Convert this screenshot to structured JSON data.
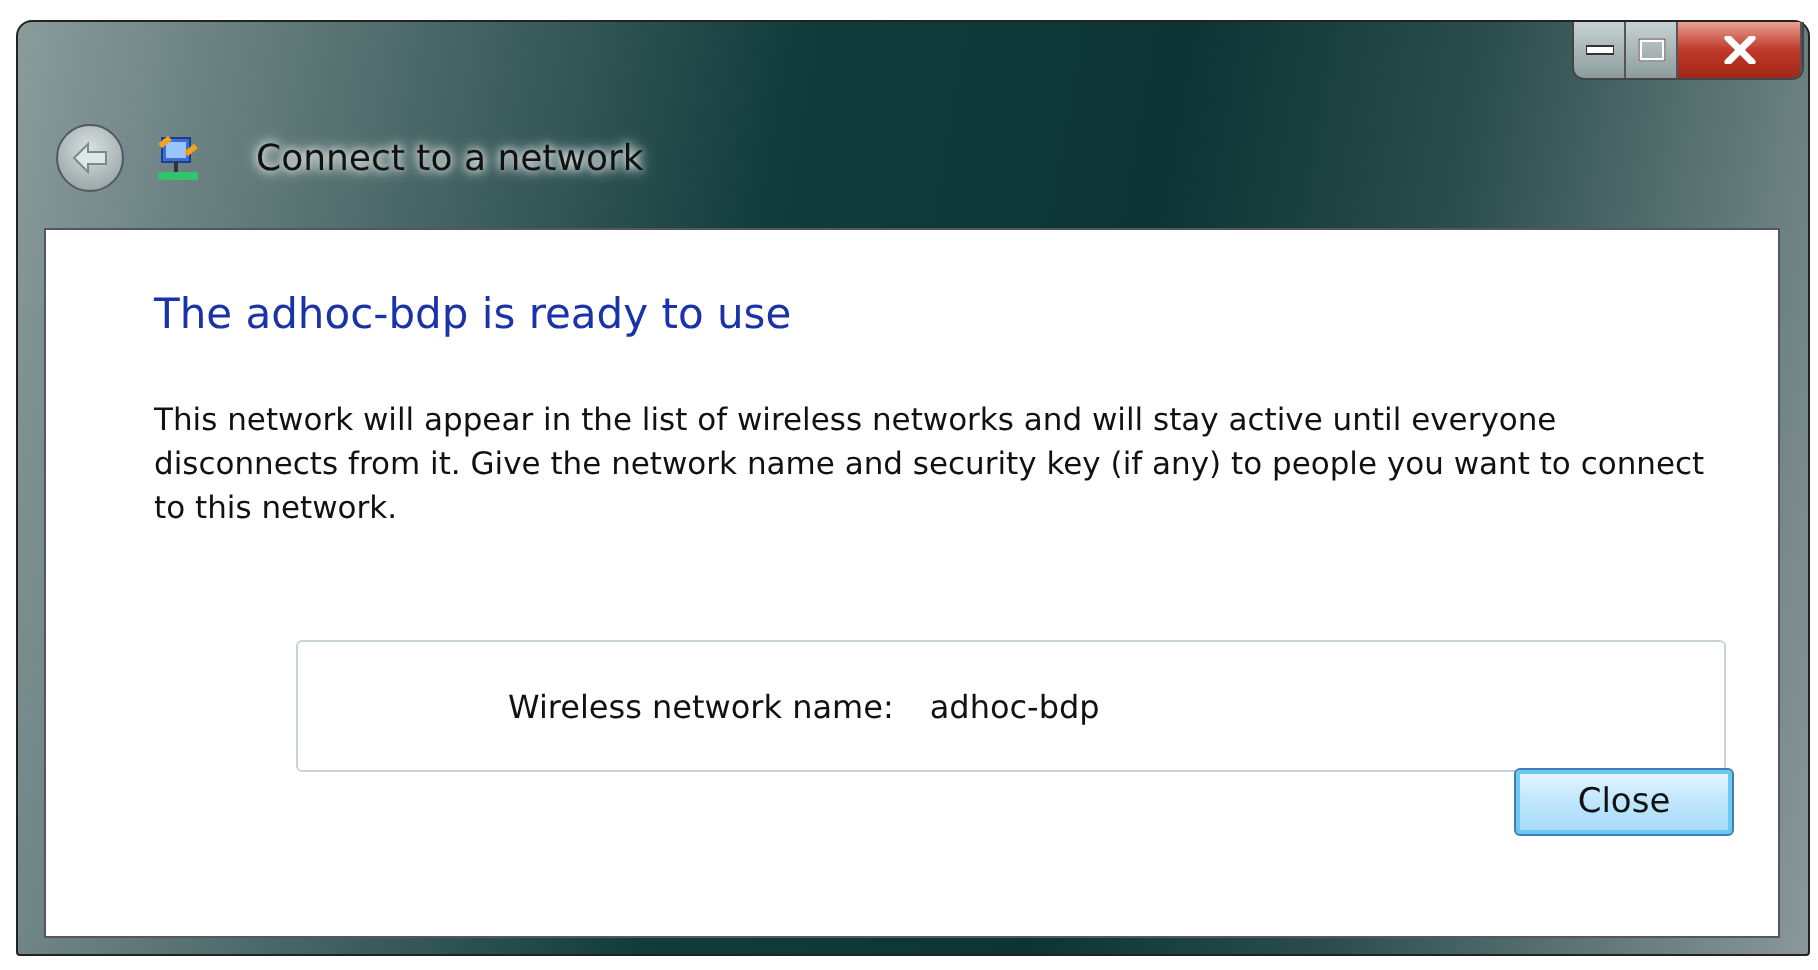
{
  "window": {
    "title": "Connect to a network"
  },
  "heading": "The adhoc-bdp is ready to use",
  "description": "This network will appear in the list of wireless networks and will stay active until everyone disconnects from it. Give the network name and security key (if any) to people you want to connect to this network.",
  "details": [
    {
      "label": "Wireless network name:",
      "value": "adhoc-bdp"
    }
  ],
  "buttons": [
    {
      "label": "Close",
      "default": true
    }
  ]
}
